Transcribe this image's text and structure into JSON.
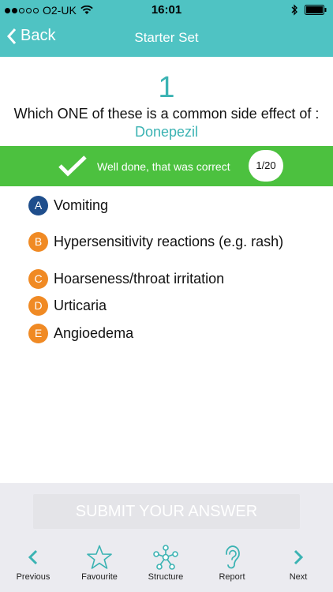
{
  "status_bar": {
    "carrier": "O2-UK",
    "time": "16:01"
  },
  "nav": {
    "back_label": "Back",
    "title": "Starter Set"
  },
  "question": {
    "number": "1",
    "text": "Which ONE of these is a common side effect of : ",
    "drug": "Donepezil"
  },
  "feedback": {
    "message": "Well done, that was correct",
    "progress": "1/20"
  },
  "options": [
    {
      "letter": "A",
      "text": "Vomiting",
      "selected": true
    },
    {
      "letter": "B",
      "text": "Hypersensitivity reactions (e.g. rash)",
      "selected": false
    },
    {
      "letter": "C",
      "text": "Hoarseness/throat irritation",
      "selected": false
    },
    {
      "letter": "D",
      "text": "Urticaria",
      "selected": false
    },
    {
      "letter": "E",
      "text": "Angioedema",
      "selected": false
    }
  ],
  "submit_label": "SUBMIT YOUR ANSWER",
  "tabs": [
    {
      "label": "Previous",
      "icon": "chevron-left-icon"
    },
    {
      "label": "Favourite",
      "icon": "star-icon"
    },
    {
      "label": "Structure",
      "icon": "network-icon"
    },
    {
      "label": "Report",
      "icon": "ear-icon"
    },
    {
      "label": "Next",
      "icon": "chevron-right-icon"
    }
  ],
  "colors": {
    "teal": "#4fc3c3",
    "green": "#4cc13f",
    "selected_badge": "#1f4e8c",
    "unselected_badge": "#f08a24"
  }
}
